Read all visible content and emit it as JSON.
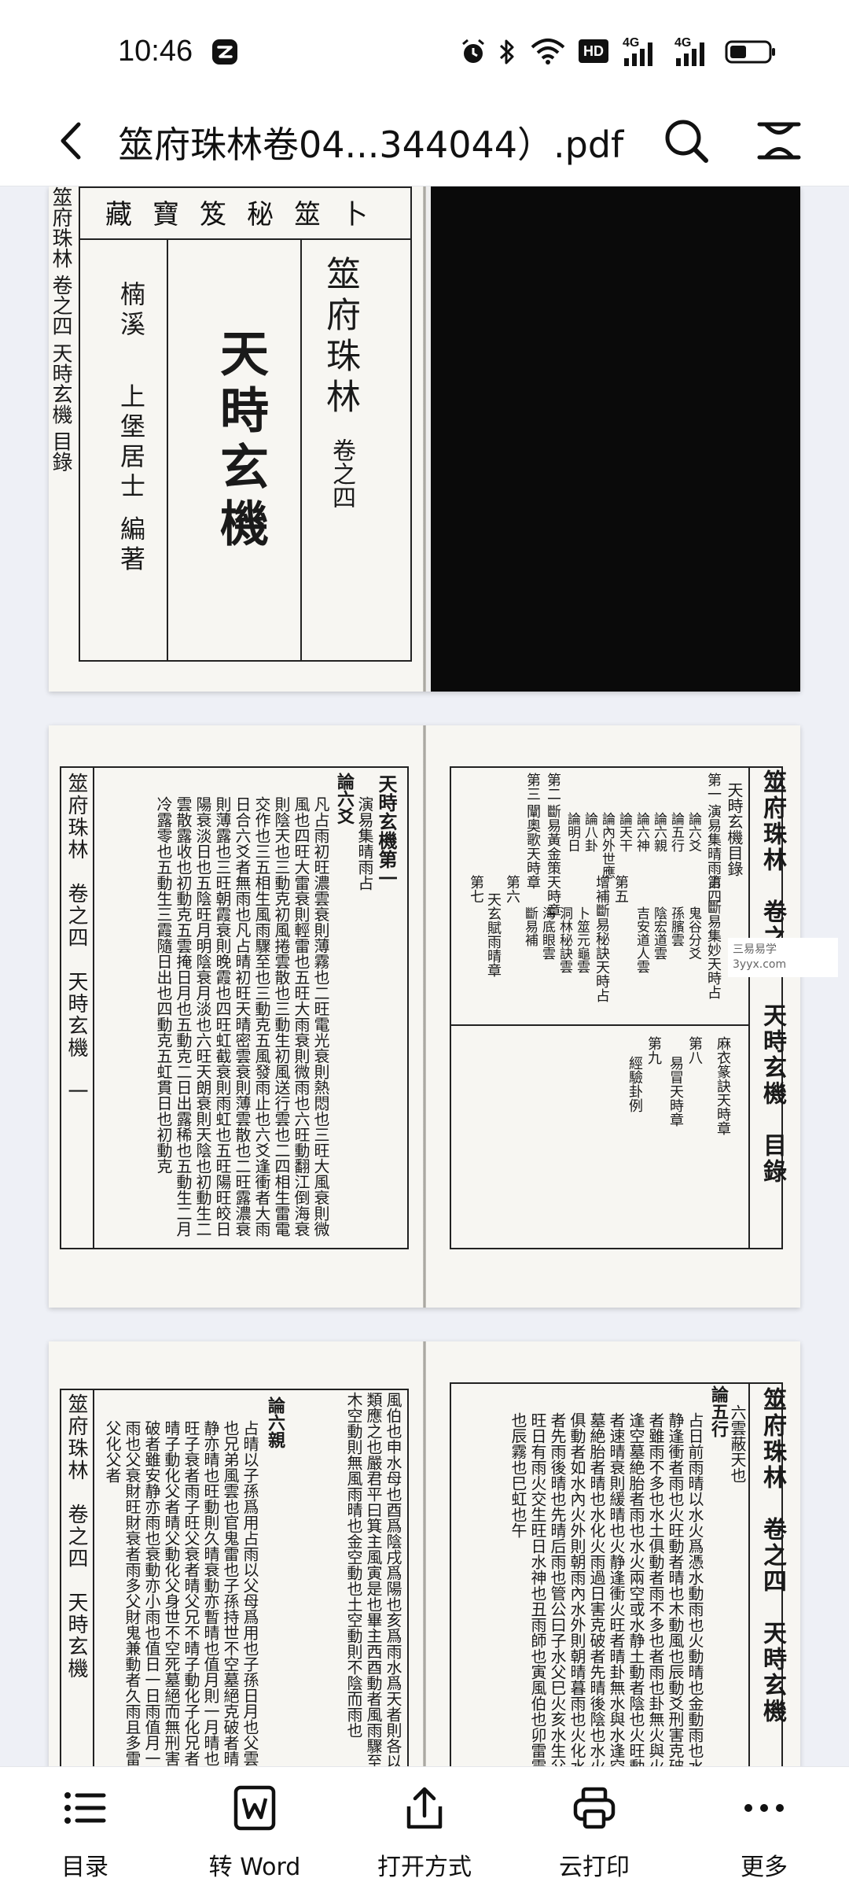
{
  "status_bar": {
    "time": "10:46",
    "icons": [
      "app-notification-icon",
      "alarm-icon",
      "bluetooth-icon",
      "wifi-icon",
      "hd-icon",
      "signal-4g-icon",
      "signal-4g-icon",
      "battery-icon"
    ],
    "hd_label": "HD",
    "net1": "4G",
    "net2": "4G"
  },
  "toolbar": {
    "title": "筮府珠林卷04...344044）.pdf"
  },
  "pages": {
    "p1_left": {
      "top_header": "卜筮秘笈寶藏",
      "main_title": "天時玄機",
      "book_title": "筮府珠林",
      "volume": "卷之四",
      "author_place": "楠溪",
      "author": "上堡居士 編著",
      "spine": [
        "筮府珠林",
        "卷之四",
        "天時玄機",
        "目錄"
      ]
    },
    "p2_left": {
      "spine": [
        "筮府珠林",
        "卷之四",
        "天時玄機",
        "一"
      ],
      "heading": "天時玄機第一",
      "sub": "演易集晴雨占",
      "section": "論六爻",
      "body": "凡占雨初旺濃雲衰則薄霧也二旺電光衰則熱悶也三旺大風衰則微風也四旺大雷衰則輕雷也五旺大雨衰則微雨也六旺動翻江倒海衰則陰天也三動克初風捲雲散也三動生初風送行雲也二四相生雷電交作也三五相生風雨驟至也三動克五風發雨止也六爻逢衝者大雨日合六爻者無雨也凡占晴初旺天晴密雲衰則薄雲散也二旺露濃衰則薄露也三旺朝霞衰則晚霞也四旺虹截衰則雨虹也五旺陽旺皎日陽衰淡日也五陰旺月明陰衰月淡也六旺天朗衰則天陰也初動生二雲散露收也初動克五雲掩日月也五動克二日出露稀也五動生二月冷露零也五動生三霞隨日出也四動克五虹貫日也初動克"
    },
    "p2_right": {
      "spine": [
        "筮府珠林",
        "卷之四",
        "天時玄機",
        "目錄"
      ],
      "toc_title": "天時玄機目錄",
      "toc": [
        {
          "num": "第一",
          "title": "演易集晴雨占",
          "items": [
            "論六爻",
            "論五行",
            "論六親",
            "論六神",
            "論天干",
            "論內外世應",
            "論八卦",
            "論明日"
          ]
        },
        {
          "num": "第二",
          "title": "斷易黃金策天時章"
        },
        {
          "num": "第三",
          "title": "闡奧歌天時章"
        },
        {
          "num": "第四",
          "title": "斷易集妙天時占",
          "items": [
            "鬼谷分爻",
            "孫臏雲",
            "陰宏道雲",
            "吉安道人雲"
          ]
        },
        {
          "num": "第五",
          "title": "增補斷易秘訣天時占",
          "items": [
            "卜筮元龜雲",
            "洞林秘訣雲",
            "海底眼雲",
            "斷易補"
          ]
        },
        {
          "num": "第六",
          "title": "天玄賦雨晴章"
        },
        {
          "num": "第七",
          "title": ""
        },
        {
          "num": "第八",
          "title": "易冒天時章"
        },
        {
          "num": "第九",
          "title": "經驗卦例"
        },
        {
          "num": "",
          "title": "麻衣篆訣天時章"
        }
      ]
    },
    "p3_left": {
      "spine": [
        "筮府珠林",
        "卷之四",
        "天時玄機"
      ],
      "body1": "風伯也申水母也酉爲陰戌爲陽也亥爲雨水爲天者則各以其類應之也嚴君平曰箕主風寅是也畢主西酉動者風雨驟至也木空動則無風雨晴也金空動也土空動則不陰而雨也",
      "section": "論六親",
      "body2": "占晴以子孫爲用占雨以父母爲用也子孫日月也父雲霧也兄弟風雲也官鬼雷也子孫持世不空墓絕克破者晴安静亦晴也旺動則久晴衰動亦暫晴也值月則一月晴也父旺子衰者雨子旺父衰者晴父兄不晴子動化子化兄者久晴子動化父者晴父動化父身世不空死墓絕而無刑害克破者雖安静亦雨也衰動亦小雨也值日一日雨值月一月雨也父衰財旺財衰者雨多父財鬼兼動者久雨且多雷也父化父者"
    },
    "p3_right": {
      "spine": [
        "筮府珠林",
        "卷之四",
        "天時玄機"
      ],
      "top_note": "六雲蔽天也",
      "section": "論五行",
      "body": "占日前雨晴以水火爲憑水動雨也火動晴也金動雨也水静逢衝者雨也火旺動者晴也木動風也辰動爻刑害克破者雖雨不多也水土俱動者雨不多也者雨也卦無火與火逢空墓絶胎者雨也水火兩空或水静土動者陰也火旺動者速晴衰則緩晴也火静逢衝火旺者晴卦無水與水逢空墓絶胎者晴也水化火雨過日害克破者先晴後陰也水火俱動者如水內火外則朝雨內水外則朝晴暮雨也火化水者先雨後晴也先晴后雨也管公曰子水父巳火亥水生父旺日有雨火交生旺日水神也丑雨師也寅風伯也卯雷震也辰霧也巳虹也午"
    }
  },
  "watermark": {
    "line1": "三易易学",
    "line2": "3yyx.com"
  },
  "bottom_nav": [
    {
      "label": "目录",
      "icon": "list-icon"
    },
    {
      "label": "转 Word",
      "icon": "word-icon"
    },
    {
      "label": "打开方式",
      "icon": "share-icon"
    },
    {
      "label": "云打印",
      "icon": "printer-icon"
    },
    {
      "label": "更多",
      "icon": "more-horizontal-icon"
    }
  ]
}
